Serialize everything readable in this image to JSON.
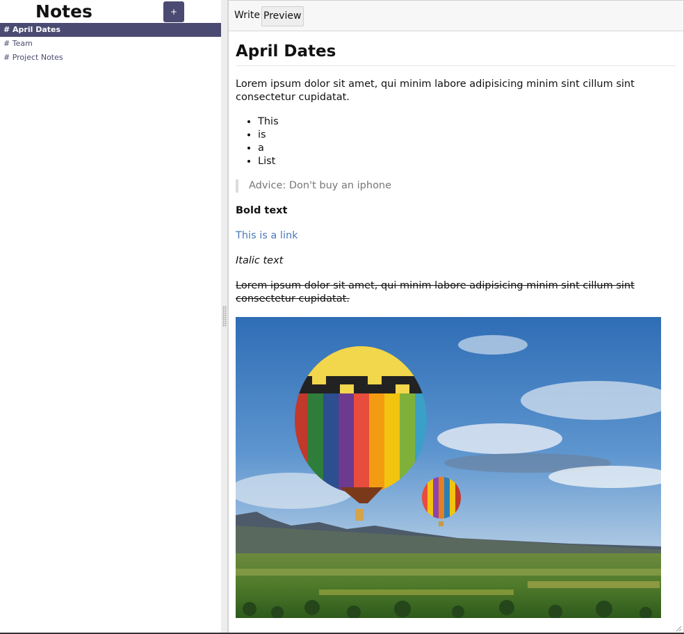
{
  "sidebar": {
    "title": "Notes",
    "add_label": "+",
    "items": [
      {
        "label": "# April Dates",
        "active": true
      },
      {
        "label": "# Team",
        "active": false
      },
      {
        "label": "# Project Notes",
        "active": false
      }
    ]
  },
  "editor": {
    "tabs": {
      "write": "Write",
      "preview": "Preview"
    },
    "active_tab": "Preview"
  },
  "document": {
    "title": "April Dates",
    "paragraph": "Lorem ipsum dolor sit amet, qui minim labore adipisicing minim sint cillum sint consectetur cupidatat.",
    "list": [
      "This",
      "is",
      "a",
      "List"
    ],
    "quote": "Advice: Don't buy an iphone",
    "bold": "Bold text",
    "link": "This is a link",
    "italic": "Italic text",
    "strike": "Lorem ipsum dolor sit amet, qui minim labore adipisicing minim sint cillum sint consectetur cupidatat."
  },
  "colors": {
    "accent": "#4a4a72",
    "link": "#4a78b8"
  }
}
